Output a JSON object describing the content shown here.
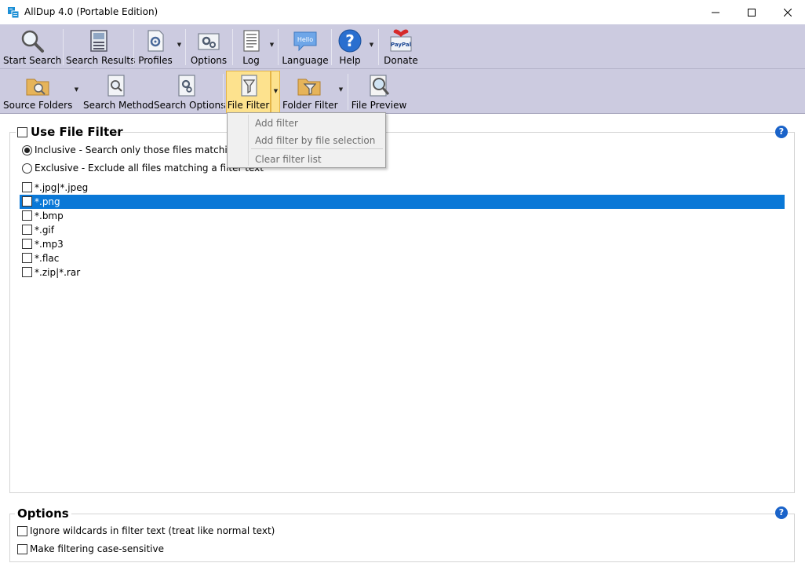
{
  "window": {
    "title": "AllDup 4.0 (Portable Edition)"
  },
  "toolbar_main": {
    "start_search": "Start Search",
    "search_results": "Search Results",
    "profiles": "Profiles",
    "options": "Options",
    "log": "Log",
    "language": "Language",
    "language_icon_text": "Hello",
    "help": "Help",
    "donate": "Donate",
    "donate_icon_text": "PayPal"
  },
  "toolbar_sub": {
    "source_folders": "Source Folders",
    "search_method": "Search Method",
    "search_options": "Search Options",
    "file_filter": "File Filter",
    "folder_filter": "Folder Filter",
    "file_preview": "File Preview"
  },
  "file_filter": {
    "title": "Use File Filter",
    "inclusive_label": "Inclusive - Search only those files matching a",
    "exclusive_label": "Exclusive - Exclude all files matching a filter text",
    "filters": [
      "*.jpg|*.jpeg",
      "*.png",
      "*.bmp",
      "*.gif",
      "*.mp3",
      "*.flac",
      "*.zip|*.rar"
    ],
    "selected_index": 1
  },
  "options": {
    "title": "Options",
    "ignore_wildcards": "Ignore wildcards in filter text (treat like normal text)",
    "case_sensitive": "Make filtering case-sensitive"
  },
  "dropdown": {
    "add_filter": "Add filter",
    "add_by_selection": "Add filter by file selection",
    "clear_list": "Clear filter list"
  },
  "colors": {
    "toolbar_bg": "#cccbe0",
    "selection": "#0a78d7",
    "active_button": "#fde28e",
    "help_blue": "#1a63c9"
  }
}
